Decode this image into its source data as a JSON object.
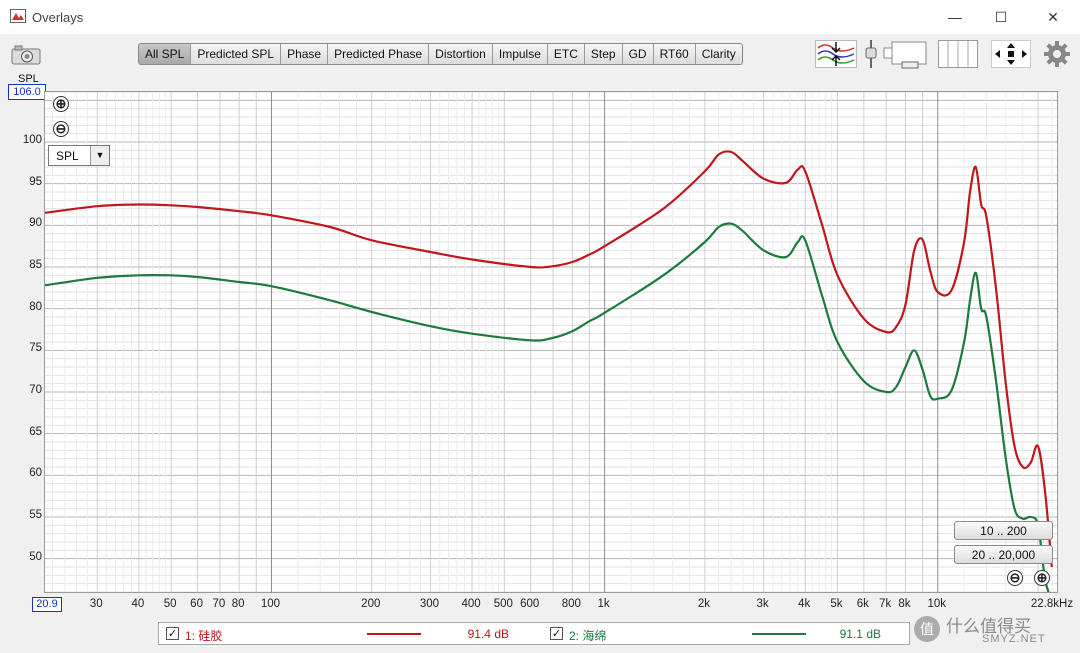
{
  "window": {
    "title": "Overlays",
    "controls": [
      "—",
      "☐",
      "✕"
    ]
  },
  "toolbar": {
    "tabs": [
      {
        "label": "All SPL",
        "active": true
      },
      {
        "label": "Predicted SPL",
        "active": false
      },
      {
        "label": "Phase",
        "active": false
      },
      {
        "label": "Predicted Phase",
        "active": false
      },
      {
        "label": "Distortion",
        "active": false
      },
      {
        "label": "Impulse",
        "active": false
      },
      {
        "label": "ETC",
        "active": false
      },
      {
        "label": "Step",
        "active": false
      },
      {
        "label": "GD",
        "active": false
      },
      {
        "label": "RT60",
        "active": false
      },
      {
        "label": "Clarity",
        "active": false
      }
    ],
    "icons": [
      "camera-icon",
      "trace-arrange-icon",
      "slider-icon",
      "window-layout-icon",
      "columns-icon",
      "move-arrows-icon",
      "gear-icon"
    ]
  },
  "plot": {
    "y_axis_label": "SPL",
    "y_max_box": "106.0",
    "x_min_box": "20.9",
    "x_max_label": "22.8kHz",
    "y_ticks": [
      "100",
      "95",
      "90",
      "85",
      "80",
      "75",
      "70",
      "65",
      "60",
      "55",
      "50"
    ],
    "x_ticks": [
      "30",
      "40",
      "50",
      "60",
      "70",
      "80",
      "100",
      "200",
      "300",
      "400",
      "500",
      "600",
      "800",
      "1k",
      "2k",
      "3k",
      "4k",
      "5k",
      "6k",
      "7k",
      "8k",
      "10k"
    ],
    "y_select": "SPL",
    "range_buttons": [
      "10 .. 200",
      "20 .. 20,000"
    ],
    "zoom_in": "⊕",
    "zoom_out": "⊖"
  },
  "chart_data": {
    "type": "line",
    "x_scale": "log",
    "xlim": [
      20.9,
      22800
    ],
    "ylim": [
      46,
      106
    ],
    "ylabel": "SPL",
    "grid": true,
    "series": [
      {
        "name": "1: 硅胶",
        "color": "#c0161c",
        "x": [
          20.9,
          30,
          40,
          50,
          60,
          80,
          100,
          150,
          200,
          300,
          400,
          600,
          700,
          800,
          900,
          1000,
          1500,
          2000,
          2200,
          2400,
          2600,
          3000,
          3500,
          3800,
          4000,
          4500,
          5000,
          6000,
          7000,
          7500,
          8000,
          8500,
          9000,
          9500,
          10000,
          11000,
          12000,
          12500,
          13000,
          13500,
          14000,
          15000,
          16000,
          17000,
          18000,
          19000,
          20000,
          21000,
          22000
        ],
        "values": [
          91.5,
          92.3,
          92.5,
          92.4,
          92.2,
          91.7,
          91.2,
          89.8,
          88.2,
          86.8,
          85.9,
          85.0,
          85.1,
          85.6,
          86.5,
          87.5,
          92,
          96.5,
          98.5,
          98.8,
          97.7,
          95.6,
          95.1,
          96.7,
          96.5,
          90,
          84,
          78.8,
          77.2,
          77.8,
          80.5,
          87,
          88.3,
          84.5,
          82,
          82.2,
          88,
          94,
          97,
          92.5,
          91,
          82,
          71,
          63.5,
          61,
          61.5,
          63.5,
          58,
          49
        ]
      },
      {
        "name": "2: 海绵",
        "color": "#1d7a3f",
        "x": [
          20.9,
          30,
          40,
          50,
          60,
          80,
          100,
          150,
          200,
          300,
          400,
          600,
          700,
          800,
          900,
          1000,
          1500,
          2000,
          2200,
          2400,
          2600,
          3000,
          3500,
          3800,
          4000,
          4500,
          5000,
          6000,
          7000,
          7500,
          8000,
          8500,
          9000,
          9500,
          10000,
          11000,
          12000,
          12500,
          13000,
          13500,
          14000,
          15000,
          16000,
          17000,
          18000,
          19000,
          20000,
          21000,
          22000
        ],
        "values": [
          82.8,
          83.7,
          84.0,
          84.0,
          83.8,
          83.2,
          82.7,
          81.0,
          79.6,
          77.9,
          77.0,
          76.2,
          76.5,
          77.3,
          78.5,
          79.5,
          84,
          88,
          89.8,
          90.2,
          89.3,
          87,
          86.2,
          88,
          88.2,
          81.5,
          76,
          71.3,
          70,
          70.6,
          73,
          75,
          72.7,
          69.5,
          69.2,
          70.2,
          76,
          81,
          84.3,
          80,
          79,
          71,
          62,
          56,
          54.8,
          55,
          54,
          47.5,
          45
        ]
      }
    ]
  },
  "legend": {
    "items": [
      {
        "checked": "✓",
        "label": "1: 硅胶",
        "value": "91.4 dB",
        "color": "#c0161c"
      },
      {
        "checked": "✓",
        "label": "2: 海绵",
        "value": "91.1 dB",
        "color": "#1d7a3f"
      }
    ]
  },
  "watermark": {
    "text_cn": "什么值得买",
    "text_en": "SMYZ.NET"
  }
}
